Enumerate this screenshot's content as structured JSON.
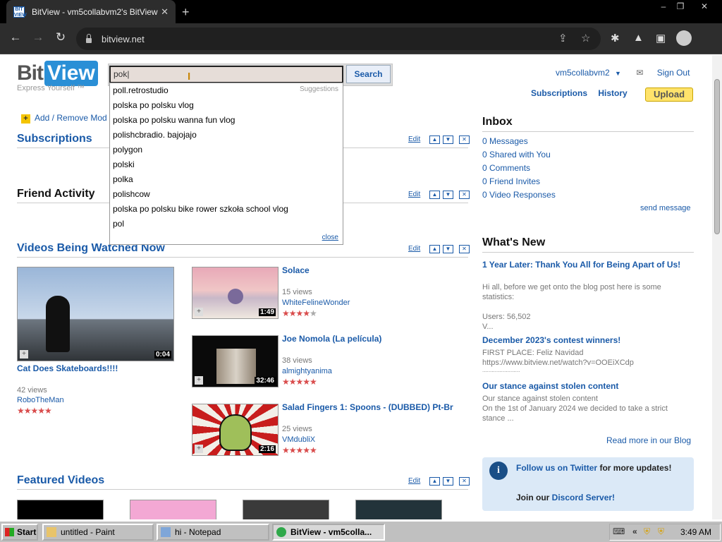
{
  "browser": {
    "tab_title": "BitView - vm5collabvm2's BitView",
    "tab_close": "✕",
    "new_tab": "+",
    "url": "bitview.net",
    "window_controls": [
      "–",
      "❐",
      "✕"
    ]
  },
  "site": {
    "logo_part1": "Bit",
    "logo_part2": "View",
    "tagline": "Express Yourself ™",
    "search_value": "pok|",
    "search_button": "Search",
    "suggestions_label": "Suggestions",
    "suggestions": [
      "poll.retrostudio",
      "polska po polsku vlog",
      "polska po polsku wanna fun vlog",
      "polishcbradio. bajojajo",
      "polygon",
      "polski",
      "polka",
      "polishcow",
      "polska po polsku bike rower szkoła school vlog",
      "pol"
    ],
    "suggestions_close": "close",
    "username": "vm5collabvm2",
    "signout": "Sign Out",
    "nav": {
      "subscriptions": "Subscriptions",
      "history": "History",
      "upload": "Upload"
    }
  },
  "modules": {
    "add_remove": "Add / Remove Mod",
    "edit": "Edit",
    "subscriptions": "Subscriptions",
    "friend_activity": "Friend Activity",
    "watched_now": "Videos Being Watched Now",
    "featured": "Featured Videos"
  },
  "videos": {
    "main": {
      "title": "Cat Does Skateboards!!!!",
      "views": "42 views",
      "user": "RoboTheMan",
      "duration": "0:04",
      "rating": 5
    },
    "list": [
      {
        "title": "Solace",
        "views": "15 views",
        "user": "WhiteFelineWonder",
        "duration": "1:49",
        "rating": 4
      },
      {
        "title": "Joe Nomola (La película)",
        "views": "38 views",
        "user": "almightyanima",
        "duration": "32:46",
        "rating": 5
      },
      {
        "title": "Salad Fingers 1: Spoons - (DUBBED) Pt-Br",
        "views": "25 views",
        "user": "VMdubliX",
        "duration": "2:16",
        "rating": 5
      }
    ]
  },
  "inbox": {
    "title": "Inbox",
    "items": [
      "0 Messages",
      "0 Shared with You",
      "0 Comments",
      "0 Friend Invites",
      "0 Video Responses"
    ],
    "send": "send message"
  },
  "news": {
    "title": "What's New",
    "items": [
      {
        "title": "1 Year Later: Thank You All for Being Apart of Us!",
        "text1": "Hi all, before we get onto the blog post here is some statistics:",
        "text2": "Users: 56,502",
        "text3": "V..."
      },
      {
        "title": "December 2023's contest winners!",
        "text1": "FIRST PLACE: Feliz Navidad",
        "text2": "https://www.bitview.net/watch?v=OOEiXCdp",
        "text3": "........................"
      },
      {
        "title": "Our stance against stolen content",
        "text1": "Our stance against stolen content",
        "text2": "On the 1st of January 2024 we decided to take a strict stance ..."
      }
    ],
    "read_more": "Read more in our Blog",
    "twitter_link": "Follow us on Twitter",
    "twitter_rest": " for more updates!",
    "discord_pre": "Join our ",
    "discord_link": "Discord Server!"
  },
  "taskbar": {
    "start": "Start",
    "items": [
      "untitled - Paint",
      "hi - Notepad",
      "BitView - vm5colla..."
    ],
    "clock": "3:49 AM"
  }
}
